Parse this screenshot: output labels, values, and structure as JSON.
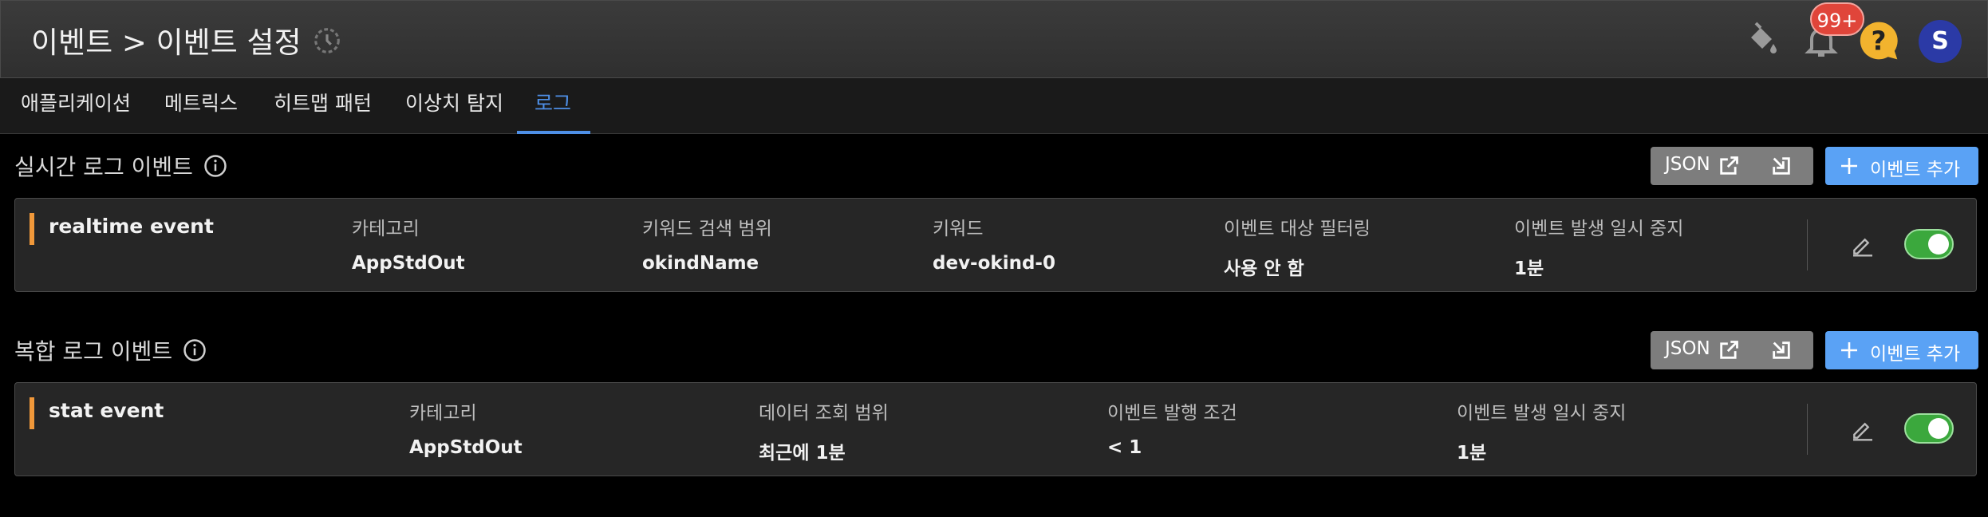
{
  "header": {
    "title": "이벤트 > 이벤트 설정",
    "notification_count": "99+",
    "avatar_initial": "S"
  },
  "tabs": [
    {
      "label": "애플리케이션"
    },
    {
      "label": "메트릭스"
    },
    {
      "label": "히트맵 패턴"
    },
    {
      "label": "이상치 탐지"
    },
    {
      "label": "로그",
      "active": true
    }
  ],
  "realtime": {
    "title": "실시간 로그 이벤트",
    "json_label": "JSON",
    "add_label": "이벤트 추가",
    "row": {
      "name": "realtime event",
      "columns": [
        {
          "key": "카테고리",
          "value": "AppStdOut"
        },
        {
          "key": "키워드 검색 범위",
          "value": "okindName"
        },
        {
          "key": "키워드",
          "value": "dev-okind-0"
        },
        {
          "key": "이벤트 대상 필터링",
          "value": "사용 안 함"
        },
        {
          "key": "이벤트 발생 일시 중지",
          "value": "1분"
        }
      ],
      "enabled": true
    }
  },
  "composite": {
    "title": "복합 로그 이벤트",
    "json_label": "JSON",
    "add_label": "이벤트 추가",
    "row": {
      "name": "stat event",
      "columns": [
        {
          "key": "카테고리",
          "value": "AppStdOut"
        },
        {
          "key": "데이터 조회 범위",
          "value": "최근에 1분"
        },
        {
          "key": "이벤트 발행 조건",
          "value": "< 1"
        },
        {
          "key": "이벤트 발생 일시 중지",
          "value": "1분"
        }
      ],
      "enabled": true
    }
  },
  "colors": {
    "accent_blue": "#4e8fe6",
    "add_button": "#5aa2f5",
    "row_accent": "#f0983a",
    "toggle_on": "#3ba83d",
    "badge": "#e0453a",
    "help": "#f2b32e"
  }
}
